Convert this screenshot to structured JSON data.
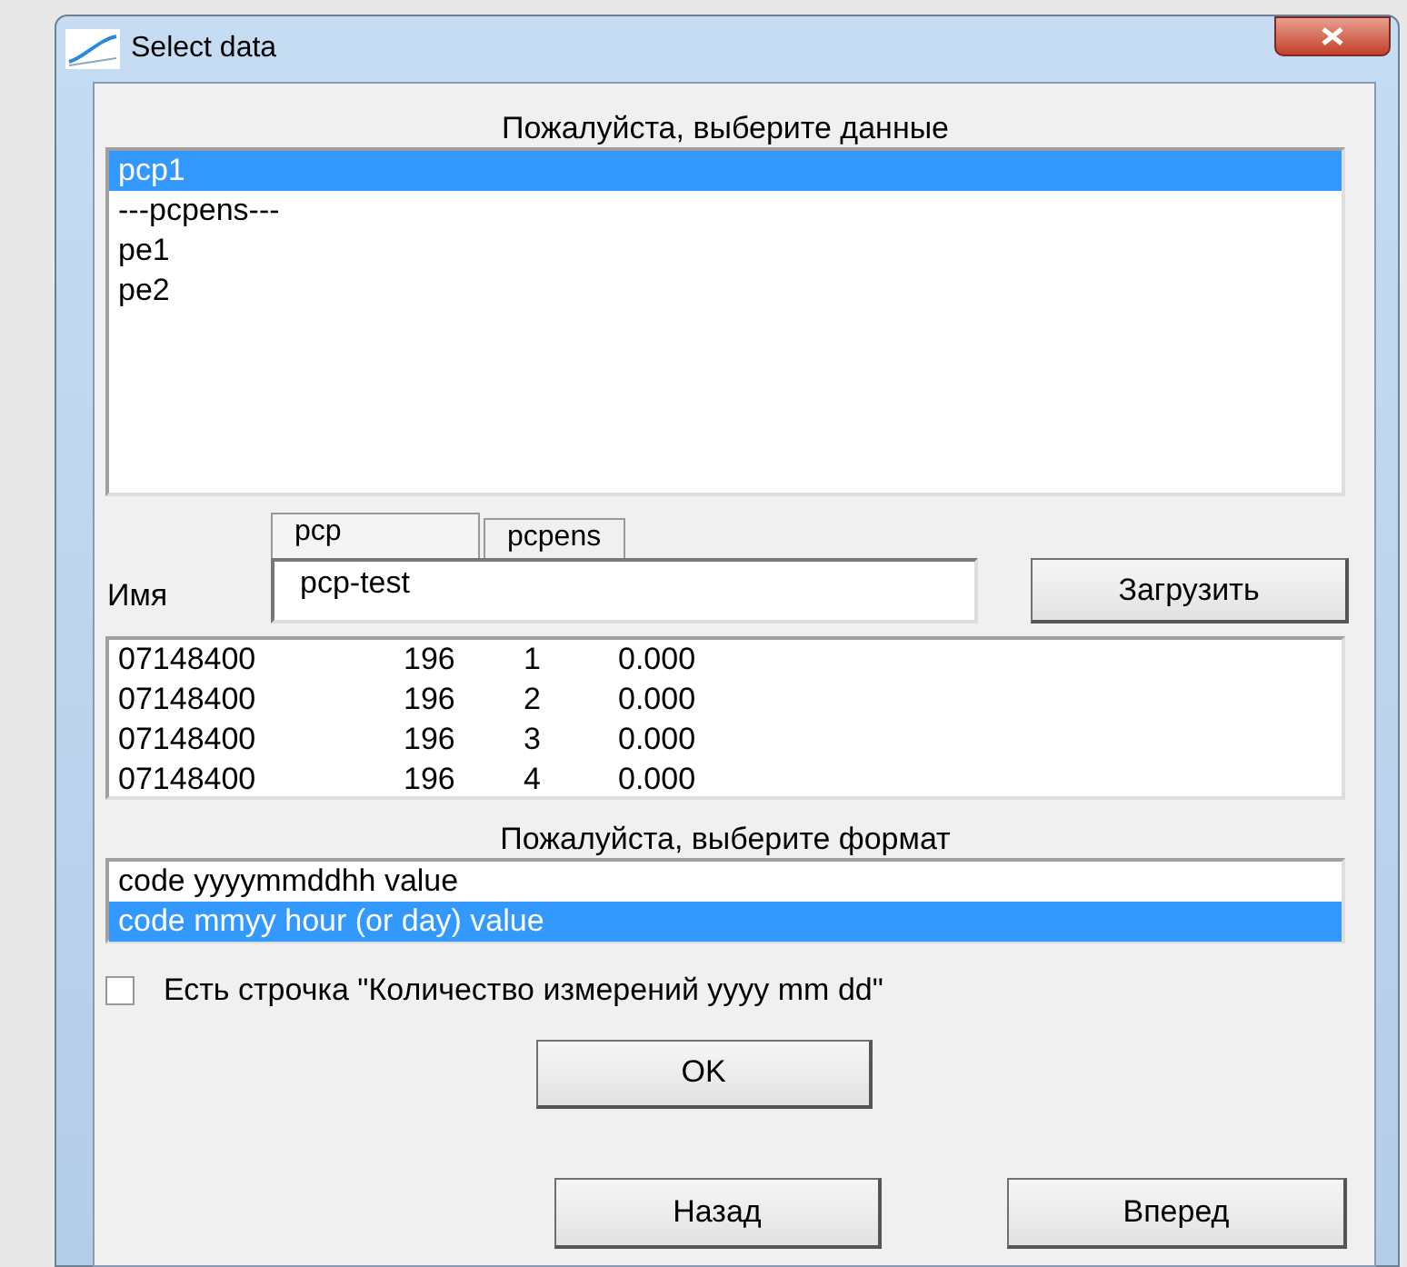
{
  "window": {
    "title": "Select data"
  },
  "data_prompt": "Пожалуйста, выберите данные",
  "data_items": [
    {
      "label": "pcp1",
      "selected": true
    },
    {
      "label": "---pcpens---",
      "selected": false
    },
    {
      "label": "pe1",
      "selected": false
    },
    {
      "label": "pe2",
      "selected": false
    }
  ],
  "tabs": [
    {
      "label": "pcp",
      "selected": true
    },
    {
      "label": "pcpens",
      "selected": false
    }
  ],
  "name_label": "Имя",
  "name_field": {
    "value": "pcp-test"
  },
  "load_button": "Загрузить",
  "preview_rows": [
    [
      "07148400",
      "196",
      "1",
      "0.000"
    ],
    [
      "07148400",
      "196",
      "2",
      "0.000"
    ],
    [
      "07148400",
      "196",
      "3",
      "0.000"
    ],
    [
      "07148400",
      "196",
      "4",
      "0.000"
    ]
  ],
  "format_prompt": "Пожалуйста, выберите формат",
  "formats": [
    {
      "label": "code yyyymmddhh value",
      "selected": false
    },
    {
      "label": "code mmyy hour (or day) value",
      "selected": true
    }
  ],
  "count_line_checkbox": {
    "label": "Есть строчка \"Количество измерений yyyy mm dd\"",
    "checked": false
  },
  "ok_button": "OK",
  "buttons": [
    "Назад",
    "Вперед"
  ]
}
